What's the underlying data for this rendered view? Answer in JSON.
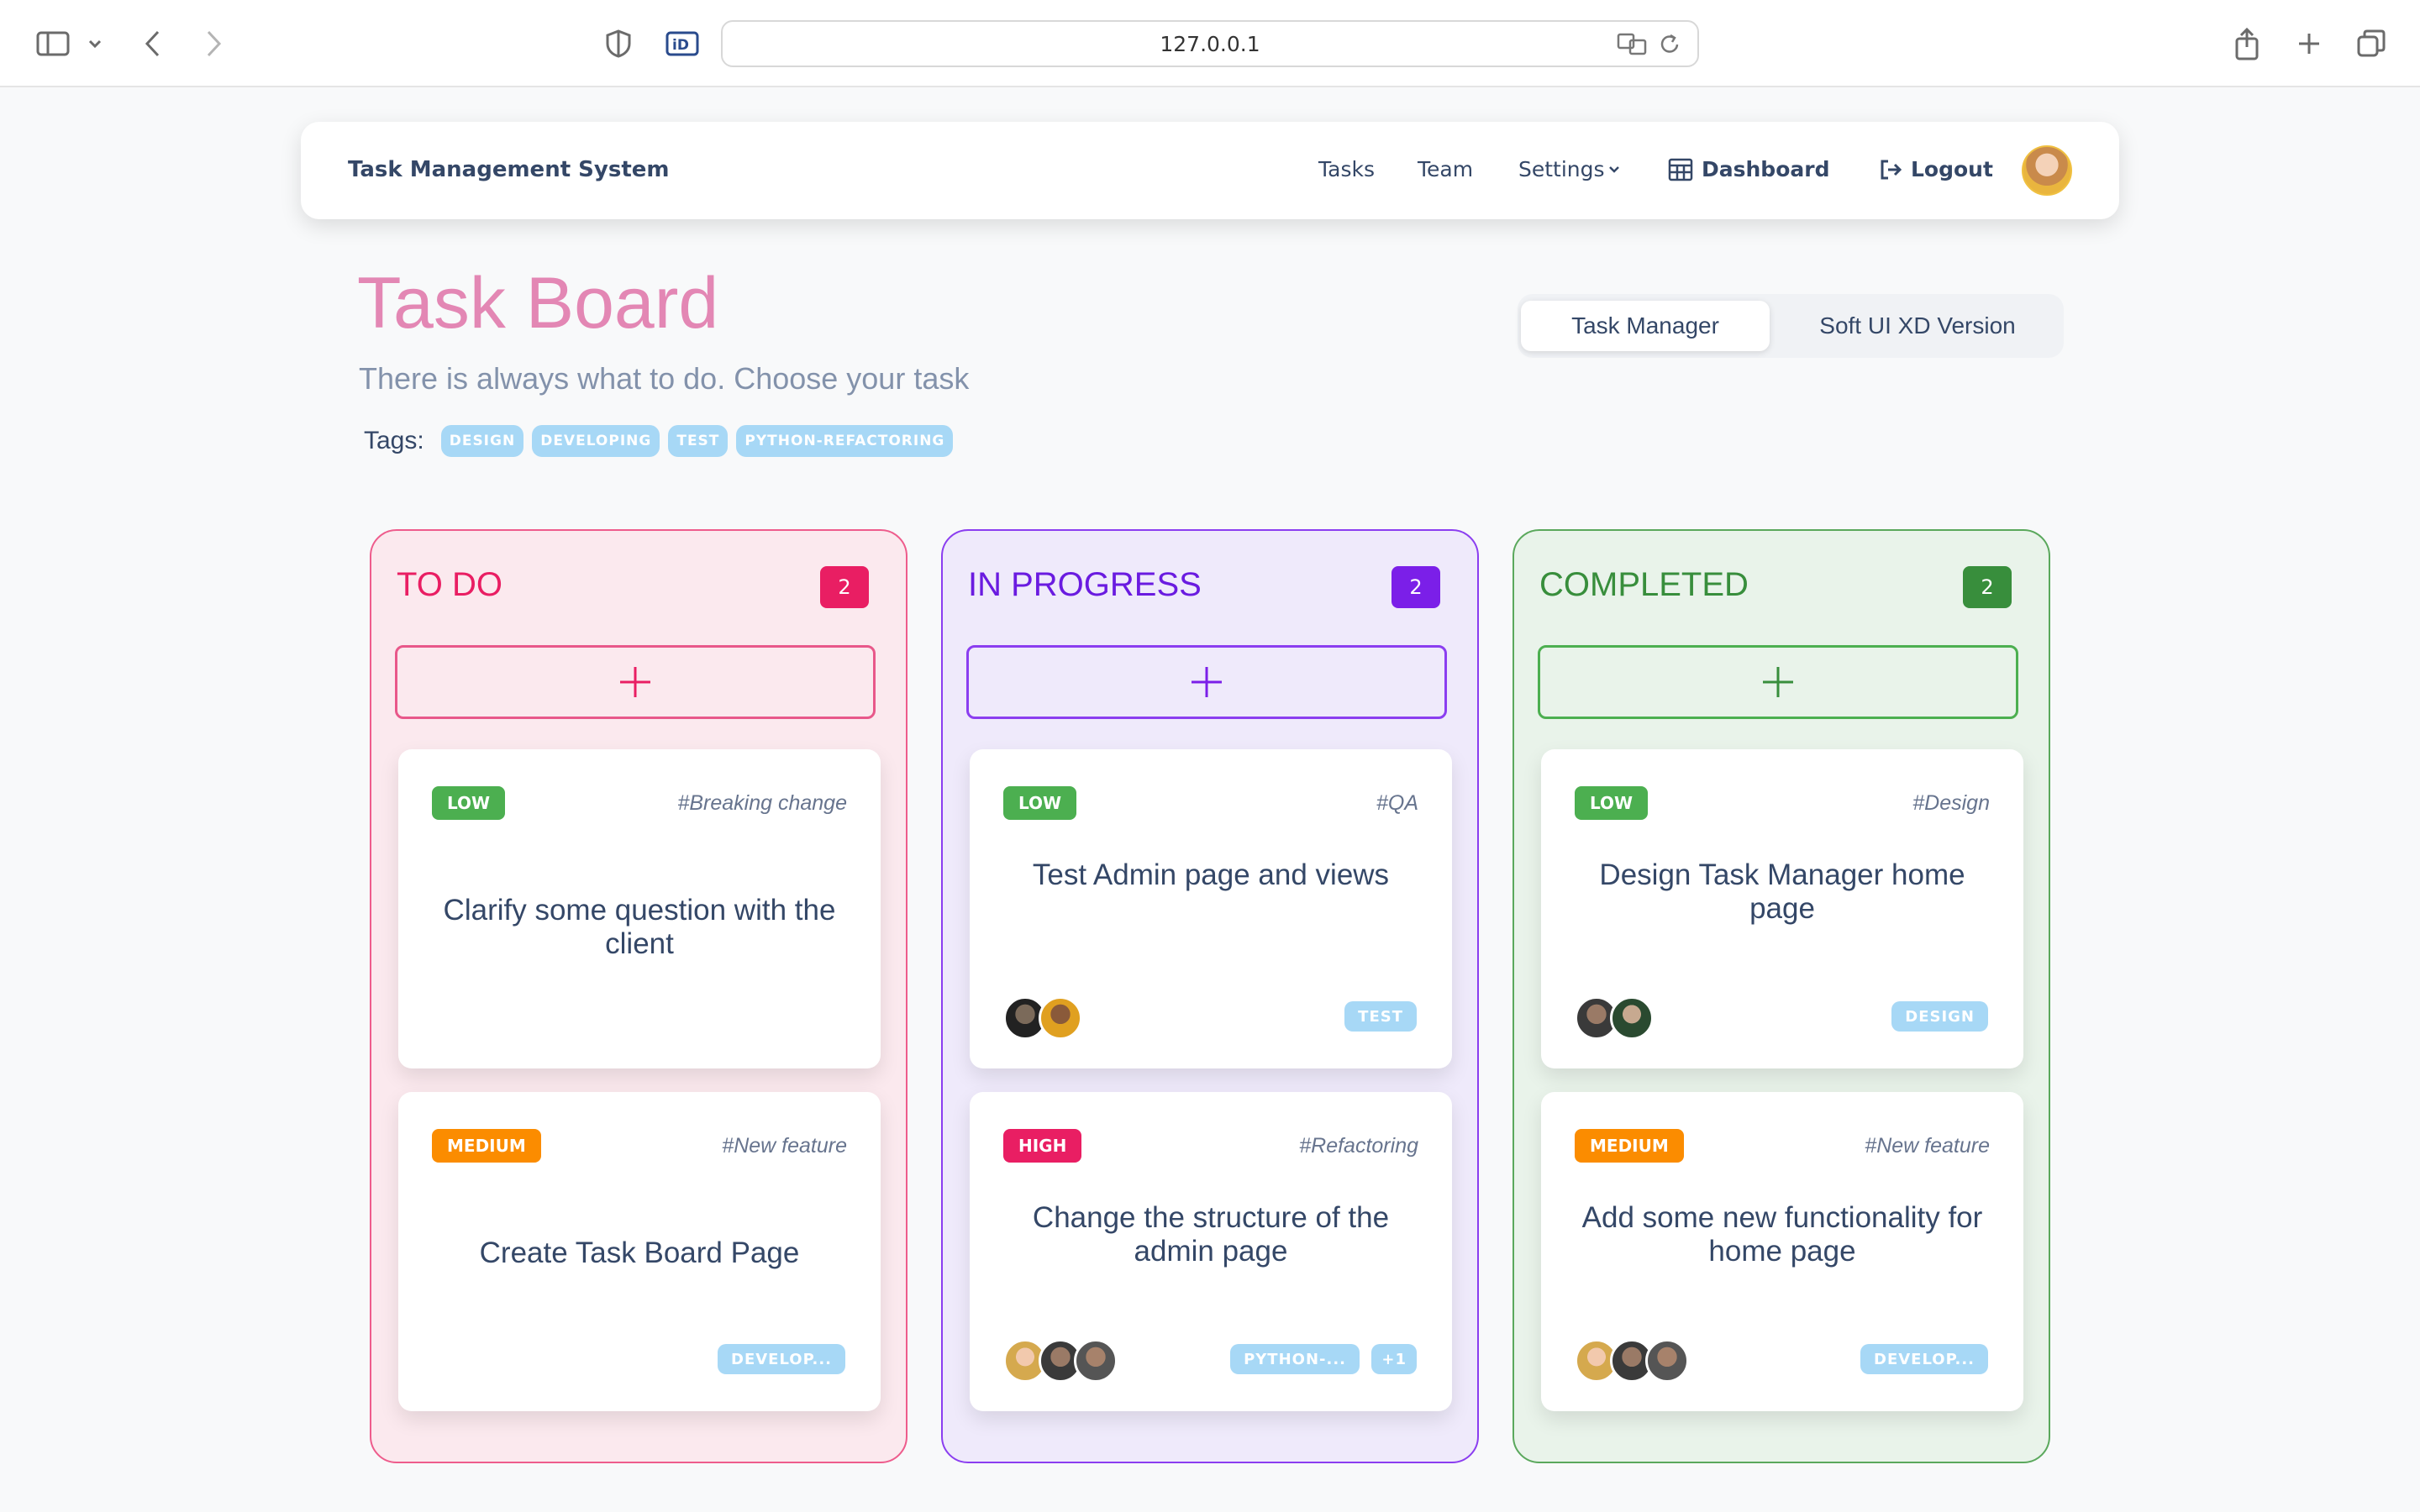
{
  "browser": {
    "url": "127.0.0.1"
  },
  "navbar": {
    "brand": "Task Management System",
    "links": {
      "tasks": "Tasks",
      "team": "Team",
      "settings": "Settings",
      "dashboard": "Dashboard",
      "logout": "Logout"
    }
  },
  "header": {
    "title": "Task Board",
    "subtitle": "There is always what to do. Choose your task",
    "tags_label": "Tags:",
    "tags": [
      "DESIGN",
      "DEVELOPING",
      "TEST",
      "PYTHON-REFACTORING"
    ]
  },
  "toggle": {
    "options": [
      "Task Manager",
      "Soft UI XD Version"
    ],
    "active": "Task Manager"
  },
  "columns": [
    {
      "title": "TO DO",
      "count": "2",
      "color": "#e91e63",
      "cards": [
        {
          "priority": "LOW",
          "hashtag": "#Breaking change",
          "text": "Clarify some question with the client",
          "tags": []
        },
        {
          "priority": "MEDIUM",
          "hashtag": "#New feature",
          "text": "Create Task Board Page",
          "tags": [
            "DEVELOP..."
          ]
        }
      ]
    },
    {
      "title": "IN PROGRESS",
      "count": "2",
      "color": "#7b1fe8",
      "cards": [
        {
          "priority": "LOW",
          "hashtag": "#QA",
          "text": "Test Admin page and views",
          "tags": [
            "TEST"
          ]
        },
        {
          "priority": "HIGH",
          "hashtag": "#Refactoring",
          "text": "Change the structure of the admin page",
          "tags": [
            "PYTHON-...",
            "+1"
          ]
        }
      ]
    },
    {
      "title": "COMPLETED",
      "count": "2",
      "color": "#388e3c",
      "cards": [
        {
          "priority": "LOW",
          "hashtag": "#Design",
          "text": "Design Task Manager home page",
          "tags": [
            "DESIGN"
          ]
        },
        {
          "priority": "MEDIUM",
          "hashtag": "#New feature",
          "text": "Add some new functionality for home page",
          "tags": [
            "DEVELOP..."
          ]
        }
      ]
    }
  ]
}
